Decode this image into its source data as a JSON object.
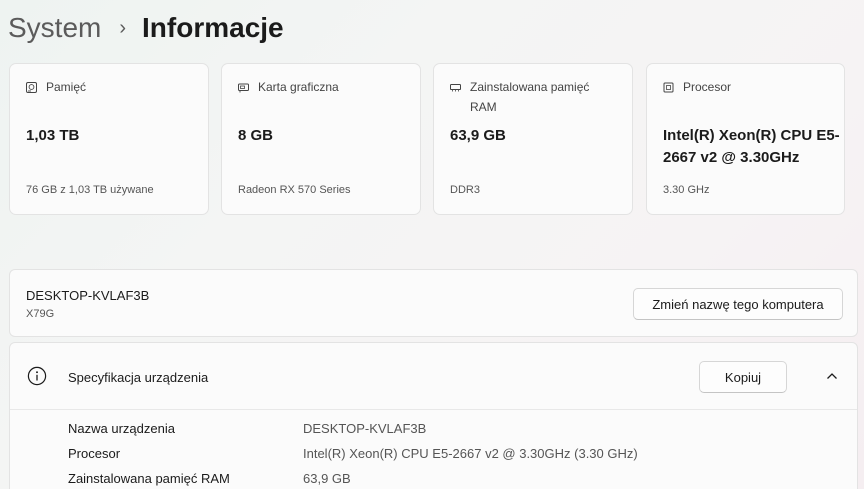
{
  "breadcrumb": {
    "parent": "System",
    "separator": "›",
    "current": "Informacje"
  },
  "cards": [
    {
      "icon": "storage-icon",
      "label": "Pamięć",
      "value": "1,03 TB",
      "sub": "76 GB z 1,03 TB używane"
    },
    {
      "icon": "gpu-icon",
      "label": "Karta graficzna",
      "value": "8 GB",
      "sub": "Radeon RX 570 Series"
    },
    {
      "icon": "ram-icon",
      "label": "Zainstalowana pamięć RAM",
      "value": "63,9 GB",
      "sub": "DDR3"
    },
    {
      "icon": "processor-icon",
      "label": "Procesor",
      "value": "Intel(R) Xeon(R) CPU E5-2667 v2 @ 3.30GHz",
      "sub": "3.30 GHz"
    }
  ],
  "computer": {
    "name": "DESKTOP-KVLAF3B",
    "model": "X79G",
    "rename_label": "Zmień nazwę tego komputera"
  },
  "specs": {
    "title": "Specyfikacja urządzenia",
    "copy_label": "Kopiuj",
    "rows": [
      {
        "key": "Nazwa urządzenia",
        "value": "DESKTOP-KVLAF3B"
      },
      {
        "key": "Procesor",
        "value": "Intel(R) Xeon(R) CPU E5-2667 v2 @ 3.30GHz (3.30 GHz)"
      },
      {
        "key": "Zainstalowana pamięć RAM",
        "value": "63,9 GB"
      }
    ]
  }
}
